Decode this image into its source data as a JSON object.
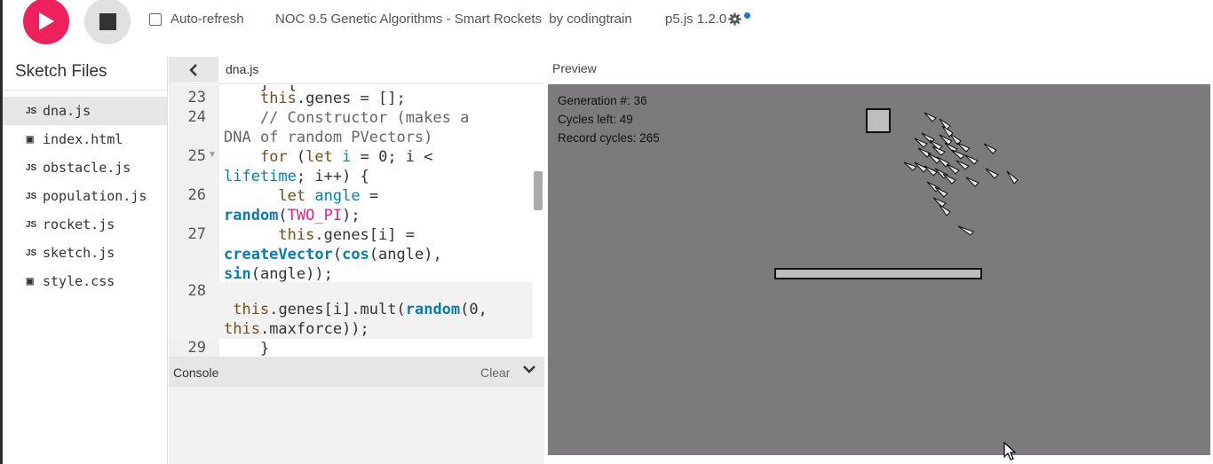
{
  "toolbar": {
    "play_label": "▶",
    "auto_refresh": "Auto-refresh",
    "project_name": "NOC 9.5 Genetic Algorithms - Smart Rockets",
    "by": "by",
    "author": "codingtrain",
    "version": "p5.js 1.2.0",
    "settings_icon": "gear-icon",
    "accent_color": "#ed225d"
  },
  "sidebar": {
    "title": "Sketch Files",
    "files": [
      {
        "icon": "JS",
        "name": "dna.js",
        "active": true
      },
      {
        "icon": "▣",
        "name": "index.html"
      },
      {
        "icon": "JS",
        "name": "obstacle.js"
      },
      {
        "icon": "JS",
        "name": "population.js"
      },
      {
        "icon": "JS",
        "name": "rocket.js"
      },
      {
        "icon": "JS",
        "name": "sketch.js"
      },
      {
        "icon": "▣",
        "name": "style.css"
      }
    ]
  },
  "editor": {
    "tab": "dna.js",
    "line_numbers": [
      "23",
      "24",
      "25",
      "26",
      "27",
      "28",
      "29"
    ]
  },
  "console": {
    "title": "Console",
    "clear": "Clear"
  },
  "preview": {
    "label": "Preview",
    "generation": "Generation #: 36",
    "cycles_left": "Cycles left: 49",
    "record": "Record cycles: 265"
  }
}
